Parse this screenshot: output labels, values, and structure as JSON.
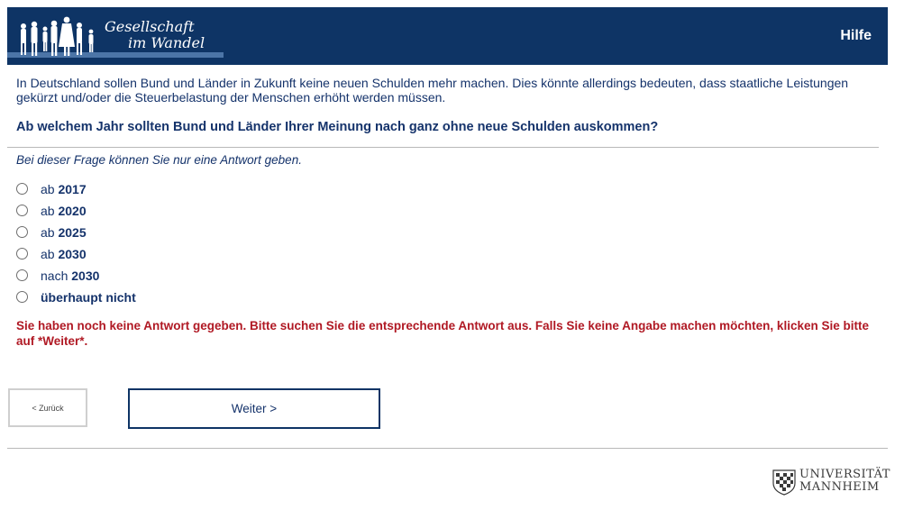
{
  "header": {
    "logo_line1": "Gesellschaft",
    "logo_line2": "im Wandel",
    "help_label": "Hilfe",
    "bg_color": "#0e3465"
  },
  "question": {
    "intro": "In Deutschland sollen Bund und Länder in Zukunft keine neuen Schulden mehr machen. Dies könnte allerdings bedeuten, dass staatliche Leistungen gekürzt und/oder die Steuerbelastung der Menschen erhöht werden müssen.",
    "text": "Ab welchem Jahr sollten Bund und Länder Ihrer Meinung nach ganz ohne neue Schulden auskommen?",
    "hint": "Bei dieser Frage können Sie nur eine Antwort geben."
  },
  "options": [
    {
      "prefix": "ab ",
      "value": "2017"
    },
    {
      "prefix": "ab ",
      "value": "2020"
    },
    {
      "prefix": "ab ",
      "value": "2025"
    },
    {
      "prefix": "ab ",
      "value": "2030"
    },
    {
      "prefix": "nach ",
      "value": "2030"
    },
    {
      "prefix": "",
      "value": "überhaupt nicht"
    }
  ],
  "error_message": "Sie haben noch keine Antwort gegeben. Bitte suchen Sie die entsprechende Antwort aus. Falls Sie keine Angabe machen möchten, klicken Sie bitte auf *Weiter*.",
  "nav": {
    "back_label": "< Zurück",
    "next_label": "Weiter >"
  },
  "footer": {
    "university_line1": "UNIVERSITÄT",
    "university_line2": "MANNHEIM"
  }
}
